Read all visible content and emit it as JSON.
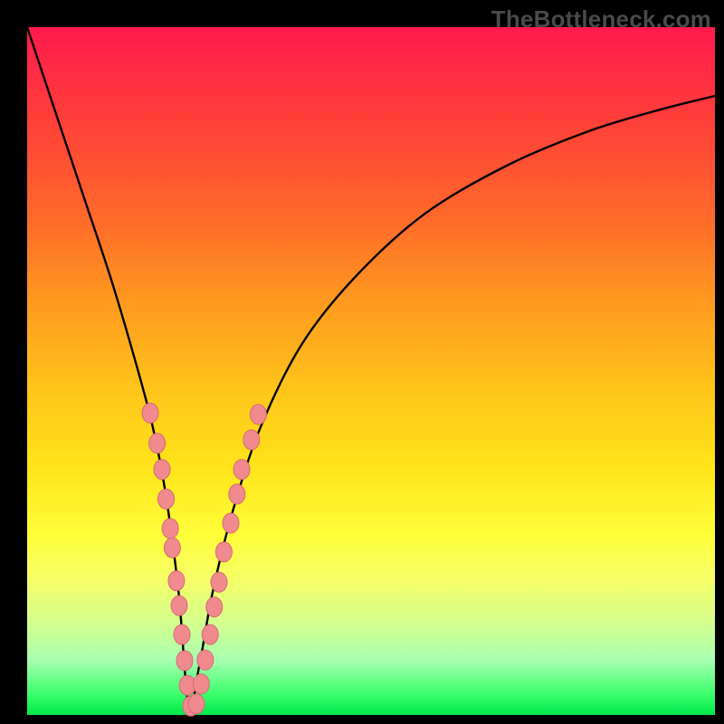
{
  "watermark": "TheBottleneck.com",
  "colors": {
    "frame": "#000000",
    "curve": "#000000",
    "marker_fill": "#f08a8f",
    "marker_stroke": "#d46a72",
    "gradient_top": "#ff1a4d",
    "gradient_bottom": "#00e84a"
  },
  "chart_data": {
    "type": "line",
    "title": "",
    "xlabel": "",
    "ylabel": "",
    "xlim": [
      0,
      100
    ],
    "ylim": [
      0,
      100
    ],
    "grid": false,
    "legend": false,
    "note": "x and y are in percent of the plot area; y=100 is top, y=0 is bottom. The curve is a V-shaped funnel with vertex near x≈24, y≈1.",
    "series": [
      {
        "name": "curve",
        "x": [
          0,
          4,
          8,
          12,
          15,
          18,
          20,
          22,
          23.5,
          25,
          27,
          30,
          34,
          40,
          48,
          58,
          70,
          82,
          92,
          100
        ],
        "y": [
          100,
          88,
          76,
          64,
          54,
          43,
          33,
          18,
          1,
          7,
          18,
          30,
          42,
          54,
          64,
          73,
          80,
          85,
          88,
          90
        ]
      }
    ],
    "markers": {
      "name": "highlighted-points",
      "note": "Salmon-colored dots clustered along both arms near the vertex",
      "points": [
        {
          "x": 17.9,
          "y": 43.9
        },
        {
          "x": 18.9,
          "y": 39.5
        },
        {
          "x": 19.6,
          "y": 35.7
        },
        {
          "x": 20.2,
          "y": 31.4
        },
        {
          "x": 20.8,
          "y": 27.1
        },
        {
          "x": 21.1,
          "y": 24.3
        },
        {
          "x": 21.7,
          "y": 19.5
        },
        {
          "x": 22.1,
          "y": 15.9
        },
        {
          "x": 22.5,
          "y": 11.7
        },
        {
          "x": 22.9,
          "y": 7.9
        },
        {
          "x": 23.3,
          "y": 4.3
        },
        {
          "x": 23.8,
          "y": 1.3
        },
        {
          "x": 24.6,
          "y": 1.6
        },
        {
          "x": 25.3,
          "y": 4.5
        },
        {
          "x": 25.9,
          "y": 8.0
        },
        {
          "x": 26.6,
          "y": 11.7
        },
        {
          "x": 27.2,
          "y": 15.7
        },
        {
          "x": 27.9,
          "y": 19.3
        },
        {
          "x": 28.6,
          "y": 23.7
        },
        {
          "x": 29.6,
          "y": 27.9
        },
        {
          "x": 30.5,
          "y": 32.1
        },
        {
          "x": 31.2,
          "y": 35.7
        },
        {
          "x": 32.6,
          "y": 40.0
        },
        {
          "x": 33.6,
          "y": 43.7
        }
      ]
    }
  }
}
